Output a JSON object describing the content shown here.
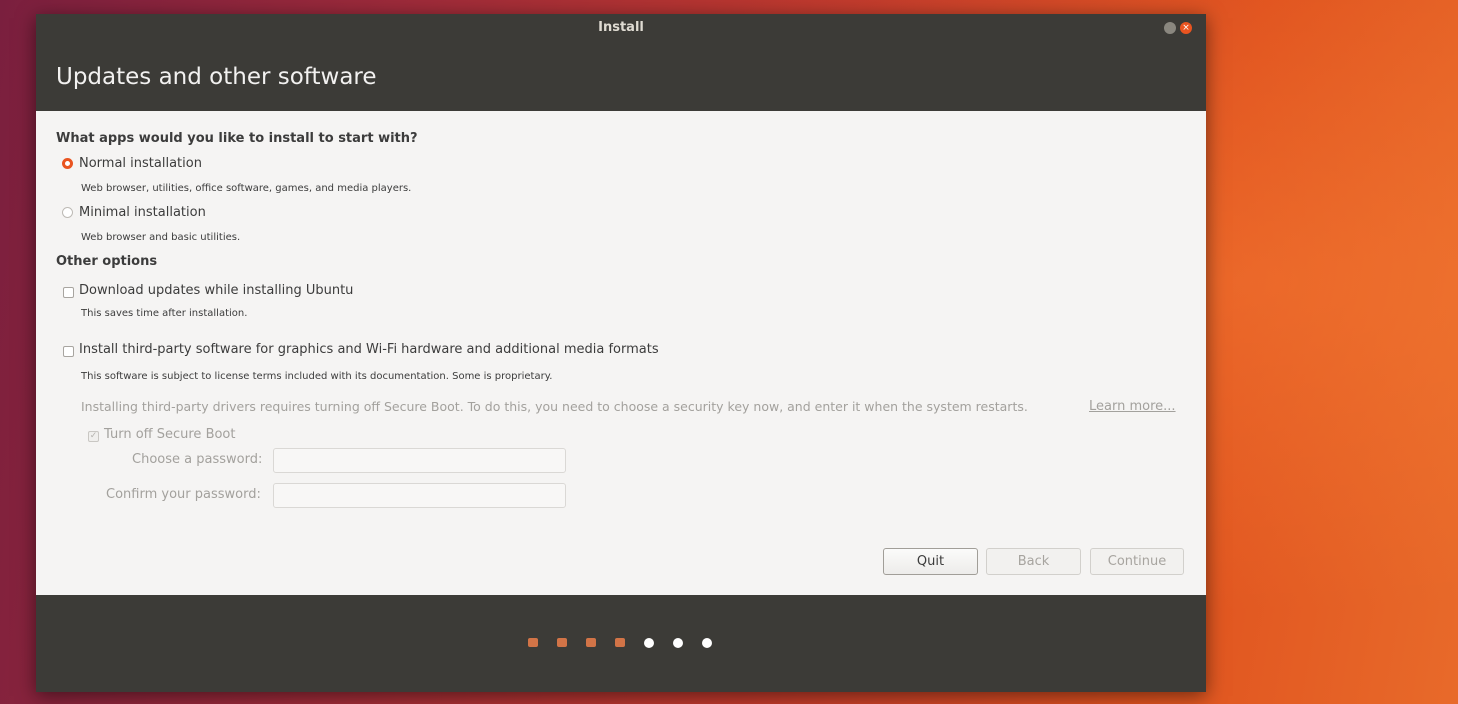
{
  "window": {
    "title": "Install",
    "header_title": "Updates and other software"
  },
  "installation": {
    "question": "What apps would you like to install to start with?",
    "normal_label": "Normal installation",
    "normal_desc": "Web browser, utilities, office software, games, and media players.",
    "minimal_label": "Minimal installation",
    "minimal_desc": "Web browser and basic utilities.",
    "selected": "normal"
  },
  "other_options": {
    "heading": "Other options",
    "updates_label": "Download updates while installing Ubuntu",
    "updates_desc": "This saves time after installation.",
    "updates_checked": false,
    "third_party_label": "Install third-party software for graphics and Wi-Fi hardware and additional media formats",
    "third_party_desc": "This software is subject to license terms included with its documentation. Some is proprietary.",
    "third_party_checked": false,
    "secure_boot_note": "Installing third-party drivers requires turning off Secure Boot. To do this, you need to choose a security key now, and enter it when the system restarts.",
    "learn_more": "Learn more...",
    "secure_boot_label": "Turn off Secure Boot",
    "secure_boot_checked": true,
    "password_label": "Choose a password:",
    "confirm_label": "Confirm your password:",
    "password_value": "",
    "confirm_value": ""
  },
  "buttons": {
    "quit": "Quit",
    "back": "Back",
    "continue": "Continue"
  },
  "progress": {
    "total_steps": 7,
    "completed_steps": 4
  },
  "colors": {
    "accent": "#e95420",
    "header_bg": "#3c3b37",
    "content_bg": "#f5f4f3"
  }
}
